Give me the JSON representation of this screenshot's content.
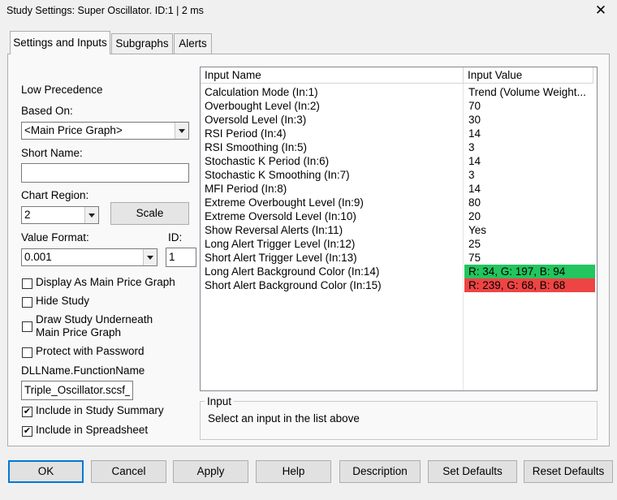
{
  "window": {
    "title": "Study Settings: Super Oscillator. ID:1 | 2 ms"
  },
  "tabs": [
    "Settings and Inputs",
    "Subgraphs",
    "Alerts"
  ],
  "left": {
    "precedence": "Low Precedence",
    "based_on_label": "Based On:",
    "based_on_value": "<Main Price Graph>",
    "short_name_label": "Short Name:",
    "short_name_value": "",
    "chart_region_label": "Chart Region:",
    "chart_region_value": "2",
    "scale_button": "Scale",
    "value_format_label": "Value Format:",
    "value_format_value": "0.001",
    "id_label": "ID:",
    "id_value": "1",
    "checkboxes": [
      {
        "label": "Display As Main Price Graph",
        "checked": false
      },
      {
        "label": "Hide Study",
        "checked": false
      },
      {
        "label": "Draw Study Underneath",
        "label2": "Main Price Graph",
        "checked": false
      },
      {
        "label": "Protect with Password",
        "checked": false
      }
    ],
    "dll_label": "DLLName.FunctionName",
    "dll_value": "Triple_Oscillator.scsf_",
    "include_summary": {
      "label": "Include in Study Summary",
      "checked": true
    },
    "include_spreadsheet": {
      "label": "Include in Spreadsheet",
      "checked": true
    }
  },
  "grid": {
    "headers": [
      "Input Name",
      "Input Value"
    ],
    "rows": [
      {
        "name": "Calculation Mode  (In:1)",
        "value": "Trend (Volume Weight..."
      },
      {
        "name": "Overbought Level  (In:2)",
        "value": "70"
      },
      {
        "name": "Oversold Level  (In:3)",
        "value": "30"
      },
      {
        "name": "RSI Period  (In:4)",
        "value": "14"
      },
      {
        "name": "RSI Smoothing  (In:5)",
        "value": "3"
      },
      {
        "name": "Stochastic K Period  (In:6)",
        "value": "14"
      },
      {
        "name": "Stochastic K Smoothing  (In:7)",
        "value": "3"
      },
      {
        "name": "MFI Period  (In:8)",
        "value": "14"
      },
      {
        "name": "Extreme Overbought Level  (In:9)",
        "value": "80"
      },
      {
        "name": "Extreme Oversold Level  (In:10)",
        "value": "20"
      },
      {
        "name": "Show Reversal Alerts  (In:11)",
        "value": "Yes"
      },
      {
        "name": "Long Alert Trigger Level  (In:12)",
        "value": "25"
      },
      {
        "name": "Short Alert Trigger Level  (In:13)",
        "value": "75"
      },
      {
        "name": "Long Alert Background Color  (In:14)",
        "value": "R: 34, G: 197, B: 94",
        "color": "#22c55e"
      },
      {
        "name": "Short Alert Background Color  (In:15)",
        "value": "R: 239, G: 68, B: 68",
        "color": "#ef4444"
      }
    ]
  },
  "input_group": {
    "legend": "Input",
    "text": "Select an input in the list above"
  },
  "buttons": [
    "OK",
    "Cancel",
    "Apply",
    "Help",
    "Description",
    "Set Defaults",
    "Reset Defaults"
  ],
  "icons": {
    "close": "close-icon",
    "dropdown": "chevron-down-icon",
    "check": "checkmark-icon"
  },
  "colors": {
    "focus_border": "#0078d7"
  }
}
